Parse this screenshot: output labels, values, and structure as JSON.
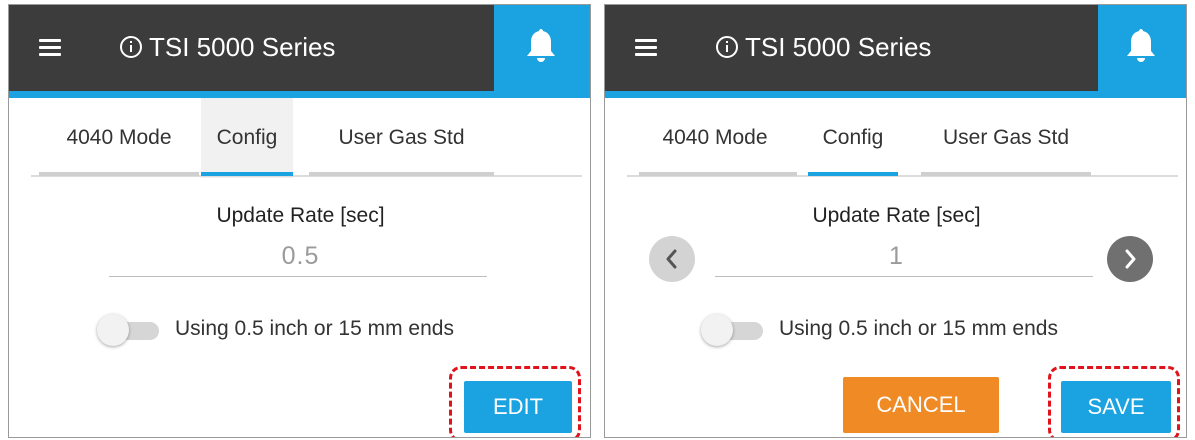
{
  "colors": {
    "appbar": "#3c3c3c",
    "accent": "#1aa3e0",
    "cancel": "#f08a24",
    "highlight": "#e0131a",
    "nav_disabled": "#d3d3d3",
    "nav_enabled": "#707070"
  },
  "panels": [
    {
      "title": "TSI 5000 Series",
      "menu_icon": "menu-icon",
      "info_icon": "info-icon",
      "bell_icon": "bell-icon",
      "tabs": [
        "4040 Mode",
        "Config",
        "User Gas Std"
      ],
      "active_tab": "Config",
      "field_label": "Update Rate [sec]",
      "field_value": "0.5",
      "toggle_label": "Using 0.5 inch or 15 mm ends",
      "toggle_on": false,
      "buttons": [
        "EDIT"
      ]
    },
    {
      "title": "TSI 5000 Series",
      "menu_icon": "menu-icon",
      "info_icon": "info-icon",
      "bell_icon": "bell-icon",
      "tabs": [
        "4040 Mode",
        "Config",
        "User Gas Std"
      ],
      "active_tab": "Config",
      "field_label": "Update Rate [sec]",
      "field_value": "1",
      "prev_icon": "chevron-left-icon",
      "next_icon": "chevron-right-icon",
      "toggle_label": "Using 0.5 inch or 15 mm ends",
      "toggle_on": false,
      "buttons": [
        "CANCEL",
        "SAVE"
      ]
    }
  ]
}
